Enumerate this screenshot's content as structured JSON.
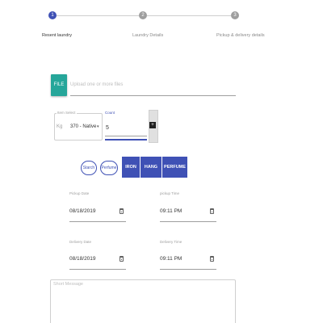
{
  "stepper": {
    "steps": [
      {
        "number": "1",
        "label": "Resent laundry",
        "active": true
      },
      {
        "number": "2",
        "label": "Laundry Details",
        "active": false
      },
      {
        "number": "3",
        "label": "Pickup & delivery details",
        "active": false
      }
    ]
  },
  "file": {
    "button_label": "FILE",
    "placeholder": "Upload one or more files"
  },
  "item": {
    "label": "Item Select",
    "unit": "Kg",
    "value": "370 - Native",
    "caret": "▾"
  },
  "count": {
    "label": "Count",
    "value": "5",
    "button_glyph": "+"
  },
  "options": {
    "starch": "Starch",
    "perfume": "Perfume"
  },
  "services": {
    "iron": "IRON",
    "hang": "HANG",
    "perfume": "PERFUME"
  },
  "pickup": {
    "date_label": "Pickup Date",
    "date_value": "08/18/2019",
    "time_label": "pickup Time",
    "time_value": "09:11 PM"
  },
  "delivery": {
    "date_label": "Delivery Date",
    "date_value": "08/18/2019",
    "time_label": "Delivery Time",
    "time_value": "09:11 PM"
  },
  "message": {
    "placeholder": "Short Message"
  },
  "colors": {
    "primary": "#3f51b5",
    "file_button": "#26a69a"
  }
}
